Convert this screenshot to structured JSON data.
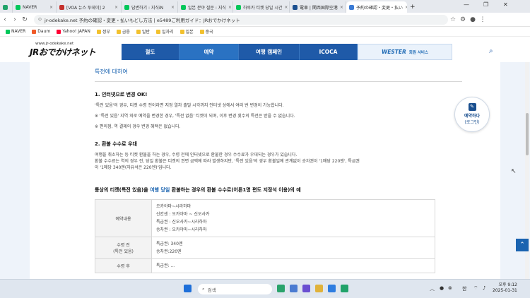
{
  "browser": {
    "tabs": [
      {
        "title": "",
        "color": "#21a36a"
      },
      {
        "title": "NAVER",
        "color": "#03c75a"
      },
      {
        "title": "[VOA 뉴스 투데이] 2",
        "color": "#c4302b"
      },
      {
        "title": "답변하기 : 지식iN",
        "color": "#03c75a"
      },
      {
        "title": "일본 분야 질문 : 지식",
        "color": "#03c75a"
      },
      {
        "title": "하루카 티켓 당일 시간",
        "color": "#03c75a"
      },
      {
        "title": "電車 | 関西国際空港",
        "color": "#1a4f8f"
      },
      {
        "title": "予約の確認・変更・払い",
        "color": "#3a7bd5"
      }
    ],
    "new_tab": "+",
    "url": "jr-odekake.net  予約の確認・変更・払いもどし方法 | e5489ご利用ガイド：JRおでかけネット",
    "bookmarks": [
      {
        "label": "NAVER",
        "color": "#03c75a"
      },
      {
        "label": "Daum",
        "color": "#f05a28"
      },
      {
        "label": "Yahoo! JAPAN",
        "color": "#ff0033"
      },
      {
        "label": "정부",
        "color": "#f2c12e"
      },
      {
        "label": "금융",
        "color": "#f2c12e"
      },
      {
        "label": "일반",
        "color": "#f2c12e"
      },
      {
        "label": "일자리",
        "color": "#f2c12e"
      },
      {
        "label": "일본",
        "color": "#f2c12e"
      },
      {
        "label": "중국",
        "color": "#f2c12e"
      }
    ]
  },
  "site": {
    "logo_small": "www.jr-odekake.net",
    "logo_big": "JRおでかけネット",
    "nav": [
      {
        "label": "철도",
        "bg": "#1f5aa8"
      },
      {
        "label": "예약",
        "bg": "#2a72c2"
      },
      {
        "label": "여행 캠페인",
        "bg": "#1f5aa8"
      },
      {
        "label": "ICOCA",
        "bg": "#1f5aa8"
      }
    ],
    "wester": "WESTER",
    "wester_sub": "회원 서비스"
  },
  "content": {
    "section_title": "특전에 대하여",
    "h1": "1. 인터넷으로 변경 OK!",
    "p1": [
      "'특전 있음'의 경우, 티켓 수령 전이라면 지정 열차 출발 시각까지 인터넷 상에서 여러 번 변경이 가능합니다.",
      "※ '특전 있음' 지역 외로 예약을 변경한 경우, '특전 없음' 티켓이 되며, 이후 변경 횟수의 특전은 받을 수 없습니다.",
      "※ 편의점, 역 결제의 경우 변경 혜택은 없습니다."
    ],
    "h2": "2. 환불 수수료 우대",
    "p2": [
      "여행을 취소하는 등 티켓 환불을 하는 경우, 수령 전에 인터넷으로 환불한 경우 수수료가 우대되는 경우가 있습니다.",
      "환불 수수료는 역의 경우 전, 당일 환불은 티켓의 권면 금액에 따라 발생하지만, '특전 있음'의 경우 환불일에 관계없이 승차권이 '1매당 220엔', 특급권",
      "이 '1매당 340엔(자유석은 220엔)'입니다."
    ],
    "bold_pre": "통상의 티켓(특전 있음)을 ",
    "bold_blue": "여행 당일",
    "bold_post": " 환불하는 경우의 환불 수수료(어른1명 편도 지정석 이용)의 예",
    "table": [
      {
        "label": "예약내용",
        "values": [
          "오카야마~시라하마",
          "신칸센 : 오카야마 ~ 신오사카",
          "특급권 : 신오사카~시라하마",
          "승차권 : 오카야마~시라하마"
        ]
      },
      {
        "label": "수령 전\n(특전 있음)",
        "values": [
          "특급권: 340엔",
          "승차권:220엔"
        ]
      },
      {
        "label": "수령 후",
        "values": [
          "특급권: ..."
        ]
      }
    ],
    "fab_label": "예약하다",
    "fab_sub": "(로그인)"
  },
  "taskbar": {
    "search_placeholder": "검색",
    "time": "오후 9:12",
    "date": "2025-01-31",
    "lang": "한"
  }
}
